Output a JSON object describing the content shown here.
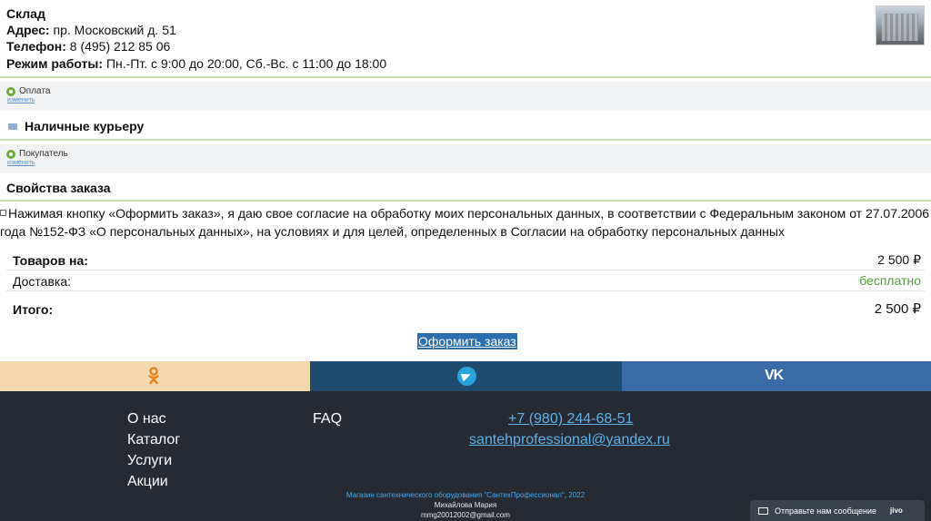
{
  "store": {
    "name": "Склад",
    "address_label": "Адрес:",
    "address": "пр. Московский д. 51",
    "phone_label": "Телефон:",
    "phone": "8 (495) 212 85 06",
    "hours_label": "Режим работы:",
    "hours": "Пн.-Пт. с 9:00 до 20:00, Сб.-Вс. с 11:00 до 18:00"
  },
  "payment": {
    "title": "Оплата",
    "change": "изменить",
    "method": "Наличные курьеру"
  },
  "buyer": {
    "title": "Покупатель",
    "change": "изменить"
  },
  "order_props_title": "Свойства заказа",
  "consent": {
    "text": "Нажимая кнопку «Оформить заказ», я даю свое согласие на обработку моих персональных данных, в соответствии с Федеральным законом от 27.07.2006 года №152-ФЗ «О персональных данных», на условиях и для целей, определенных в Согласии на обработку персональных данных"
  },
  "totals": {
    "goods_label": "Товаров на:",
    "goods_value": "2 500 ₽",
    "delivery_label": "Доставка:",
    "delivery_value": "бесплатно",
    "total_label": "Итого:",
    "total_value": "2 500 ₽"
  },
  "order_button": "Оформить заказ",
  "social": {
    "ok_icon": "odnoklassniki-icon",
    "tg_icon": "telegram-icon",
    "vk_icon": "vk-icon",
    "vk_text": "VK"
  },
  "footer": {
    "nav1": [
      "О нас",
      "Каталог",
      "Услуги",
      "Акции"
    ],
    "nav2": [
      "FAQ"
    ],
    "phone": "+7 (980) 244-68-51",
    "email": "santehprofessional@yandex.ru",
    "copyright": "Магазин сантехнического оборудования \"СантехПрофессионал\", 2022",
    "author": "Михайлова Мария",
    "author_email": "mmg20012002@gmail.com"
  },
  "chat": {
    "label": "Отправьте нам сообщение",
    "brand": "jivo"
  },
  "colors": {
    "accent_green": "#6cab3a",
    "link_blue": "#5fb3e8",
    "footer_bg": "#252a33",
    "button_bg": "#2c6fae"
  }
}
